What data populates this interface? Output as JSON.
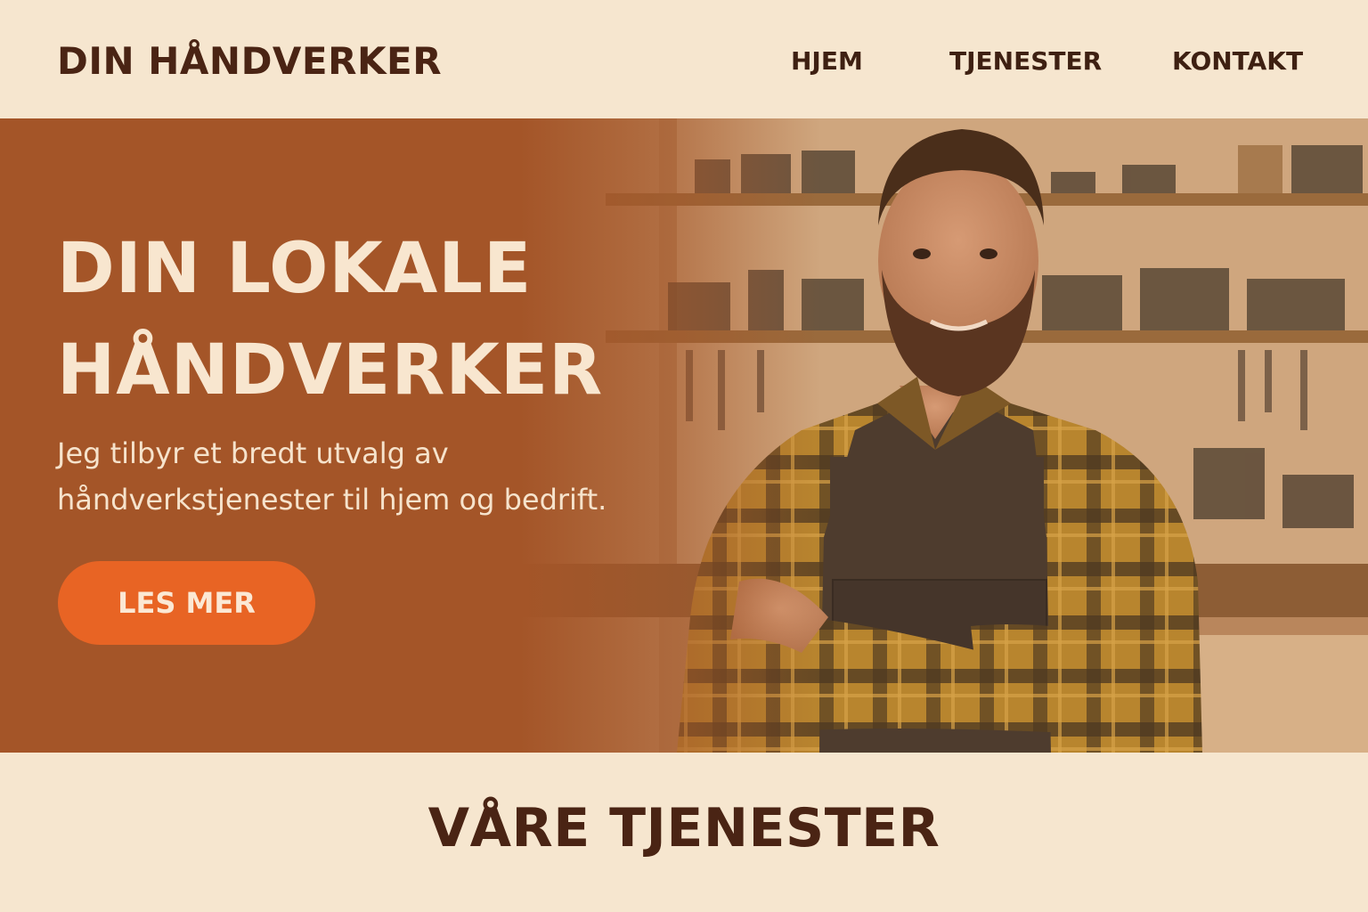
{
  "header": {
    "logo": "DIN HÅNDVERKER",
    "nav": [
      {
        "label": "HJEM"
      },
      {
        "label": "TJENESTER"
      },
      {
        "label": "KONTAKT"
      }
    ]
  },
  "hero": {
    "title_lines": [
      "DIN LOKALE",
      "HÅNDVERKER"
    ],
    "subtitle_lines": [
      "Jeg tilbyr et bredt utvalg av",
      "håndverkstjenester til hjem og bedrift."
    ],
    "cta_label": "LES MER",
    "image": "smiling-craftsman-in-workshop"
  },
  "services": {
    "title": "VÅRE TJENESTER"
  },
  "colors": {
    "background": "#f6e6cf",
    "hero_panel": "#a45528",
    "cta": "#e86424",
    "dark_text": "#4a2414"
  }
}
